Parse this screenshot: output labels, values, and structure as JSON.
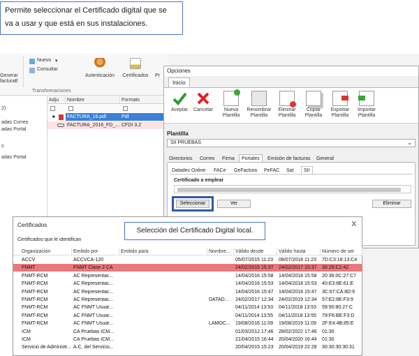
{
  "callout_top": {
    "line1": "Permite seleccionar el Certificado digital que se",
    "line2": "va a usar y que está en sus instalaciones."
  },
  "callout_dialog": "Selección del Certificado Digital local.",
  "ribbon": {
    "generar": "Generar",
    "factura": "facturaE",
    "adjuntar": "Adjun",
    "nuevo": "Nuevo",
    "consultar": "Consultar",
    "autenticacion": "Autenticación",
    "certificados": "Certificados",
    "pr": "Pr",
    "group": "Transformaciones"
  },
  "sidenav": [
    "2)",
    "adas Correo",
    "adas Portal",
    "s",
    "adas Portal"
  ],
  "file_grid": {
    "headers": [
      "Adju",
      "Nombre",
      "Formato"
    ],
    "rows": [
      {
        "name": "FACTURA_16.pdf",
        "format": "Pdf"
      },
      {
        "name": "FACTURA_2016_FD_...",
        "format": "CFDI 3.2"
      }
    ]
  },
  "opciones": {
    "title": "Opciones",
    "tab": "Inicio",
    "buttons": [
      {
        "label1": "Aceptar",
        "label2": "",
        "icon": "check-icon"
      },
      {
        "label1": "Cancelar",
        "label2": "",
        "icon": "cancel-icon"
      },
      {
        "label1": "Nueva",
        "label2": "Plantilla",
        "icon": "new-template-icon"
      },
      {
        "label1": "Renombrar",
        "label2": "Plantilla",
        "icon": "rename-template-icon"
      },
      {
        "label1": "Eliminar",
        "label2": "Plantilla",
        "icon": "delete-template-icon"
      },
      {
        "label1": "Copiar",
        "label2": "Plantilla",
        "icon": "copy-template-icon"
      },
      {
        "label1": "Exportar",
        "label2": "Plantilla",
        "icon": "export-template-icon"
      },
      {
        "label1": "Importar",
        "label2": "Plantilla",
        "icon": "import-template-icon"
      }
    ],
    "plantilla_label": "Plantilla",
    "plantilla_value": "SII PRUEBAS",
    "tabs": [
      "Directorios",
      "Correo",
      "Firma",
      "Portales",
      "Emisión de facturas",
      "General"
    ],
    "subtabs": [
      "Datadec Online",
      "FACe",
      "GeFactura",
      "PeFAC",
      "Sat",
      "SII"
    ],
    "cert_label": "Certificado a emplear",
    "btn_seleccionar": "Seleccionar",
    "btn_ver": "Ver",
    "btn_eliminar": "Eliminar"
  },
  "cert_dialog": {
    "title": "Certificados",
    "close": "X",
    "subtitle": "Certificados que le identifican",
    "headers": [
      "Organización",
      "Emitido por",
      "Emitido para",
      "Nombre...",
      "Válido desde",
      "Válido hasta",
      "Número de ser"
    ],
    "rows": [
      {
        "org": "ACCV",
        "by": "ACCVCA-120",
        "name": "",
        "from": "05/07/2015 11:23",
        "to": "08/07/2018 11:23",
        "serial": "7D:C3:18:13:C4"
      },
      {
        "org": "FNMT",
        "by": "FNMT Clase 2 CA",
        "name": "",
        "from": "24/02/2015 15:37",
        "to": "24/02/2017 15:37",
        "serial": "30:29:C2:42"
      },
      {
        "org": "FNMT-RCM",
        "by": "AC Representac...",
        "name": "",
        "from": "14/04/2016 15:58",
        "to": "14/04/2018 15:58",
        "serial": "20:36:0C:27:C7"
      },
      {
        "org": "FNMT-RCM",
        "by": "AC Representac...",
        "name": "",
        "from": "14/04/2016 15:53",
        "to": "14/04/2018 15:53",
        "serial": "40:E3:8E:61:E"
      },
      {
        "org": "FNMT-RCM",
        "by": "AC Representac...",
        "name": "",
        "from": "14/04/2016 15:47",
        "to": "14/04/2018 15:47",
        "serial": "3C:67:CA:8D:9"
      },
      {
        "org": "FNMT-RCM",
        "by": "AC Representac...",
        "name": "DATAD...",
        "from": "24/02/2017 12:34",
        "to": "24/02/2019 12:34",
        "serial": "57:E2:8E:F3:9"
      },
      {
        "org": "FNMT-RCM",
        "by": "AC FNMT Usuar...",
        "name": "",
        "from": "04/11/2014 13:53",
        "to": "04/11/2018 13:53",
        "serial": "59:90:80:27:C"
      },
      {
        "org": "FNMT-RCM",
        "by": "AC FNMT Usuar...",
        "name": "",
        "from": "04/11/2014 13:55",
        "to": "04/11/2018 13:55",
        "serial": "79:F6:BE:F3:D"
      },
      {
        "org": "FNMT-RCM",
        "by": "AC FNMT Usuar...",
        "name": "LAMOC...",
        "from": "19/08/2016 11:09",
        "to": "19/08/2019 11:09",
        "serial": "2F:E4:4B:85:E"
      },
      {
        "org": "ICM",
        "by": "CA Pruebas ICM...",
        "name": "",
        "from": "01/03/2012 17:46",
        "to": "28/02/2022 17:46",
        "serial": "01:30"
      },
      {
        "org": "ICM",
        "by": "CA Pruebas ICM...",
        "name": "",
        "from": "21/04/2015 16:44",
        "to": "20/04/2020 16:44",
        "serial": "01:30"
      },
      {
        "org": "Servicio de Administr...",
        "by": "A.C. del Servicio...",
        "name": "",
        "from": "20/04/2015 15:23",
        "to": "20/04/2019 22:28",
        "serial": "30:30:30:30:31"
      }
    ]
  },
  "colors": {
    "highlight_row": "#e8797c",
    "selected_file": "#3b7fd8",
    "accent": "#3a6dbb"
  }
}
